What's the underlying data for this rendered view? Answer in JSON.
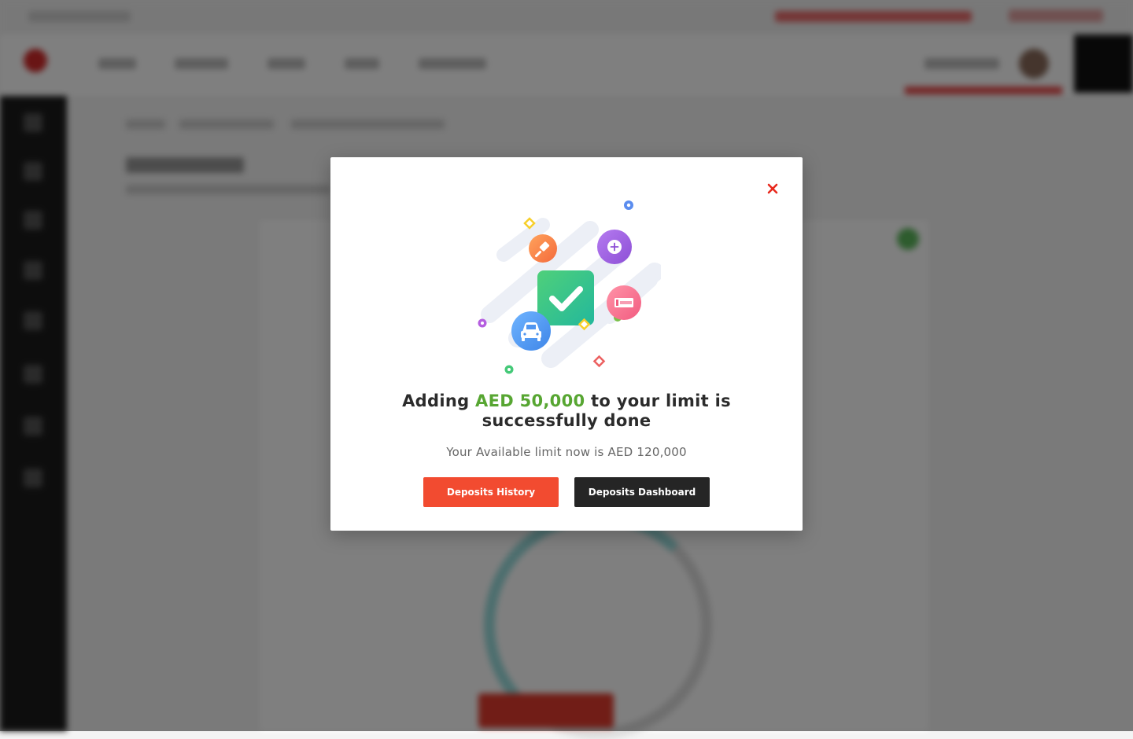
{
  "modal": {
    "message_prefix": "Adding ",
    "amount": "AED 50,000",
    "message_suffix_line1": " to your limit is",
    "message_line2": "successfully done",
    "subtext": "Your Available limit now is AED 120,000",
    "history_button": "Deposits History",
    "dashboard_button": "Deposits Dashboard"
  },
  "colors": {
    "accent_red": "#f24b30",
    "dark_button": "#252525",
    "success_green": "#57a632",
    "close_red": "#e8291d"
  },
  "icons": [
    "close-icon",
    "check-icon",
    "gavel-icon",
    "plus-icon",
    "car-icon",
    "plate-icon"
  ]
}
